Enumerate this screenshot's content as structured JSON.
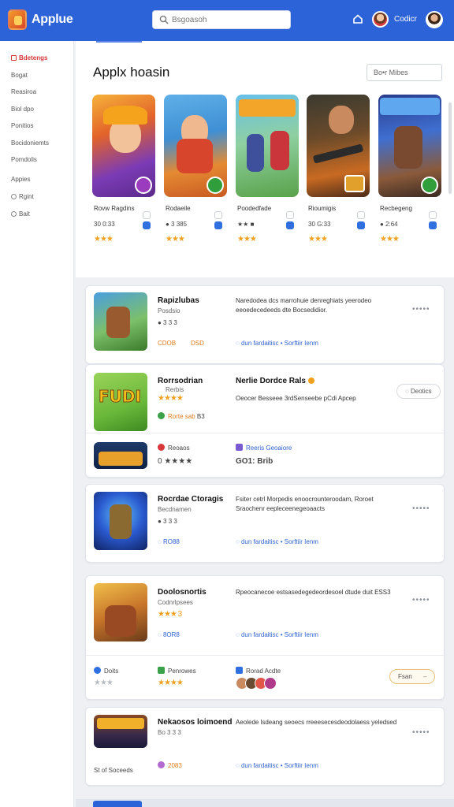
{
  "header": {
    "app_title": "Applue",
    "search_placeholder": "Bsgoasoh",
    "user_name": "Codicr"
  },
  "sidebar": {
    "items": [
      {
        "label": "Bdetengs",
        "icon": "grid-icon",
        "active": true
      },
      {
        "label": "Bogat"
      },
      {
        "label": "Reasiroa"
      },
      {
        "label": "Biol dpo"
      },
      {
        "label": "Ponitios"
      },
      {
        "label": "Bocidoniemts"
      },
      {
        "label": "Pomdolis"
      },
      {
        "label": "Appies"
      },
      {
        "label": "Rgint",
        "icon": "settings-icon"
      },
      {
        "label": "Bait",
        "icon": "gear-icon"
      }
    ]
  },
  "featured": {
    "title": "Applx hoasin",
    "more_label": "Bo•r Mibes",
    "games": [
      {
        "name": "Rovw Ragdins",
        "price": "30 0:33",
        "stars": "★★★",
        "badge_color": "#9b3bbd"
      },
      {
        "name": "Rodaeile",
        "price": "● 3 385",
        "stars": "★★★",
        "badge_color": "#2f9e3b"
      },
      {
        "name": "Poodedfade",
        "price": "★★ ■",
        "stars": "★★★",
        "badge_color": "#d84d2c"
      },
      {
        "name": "Rioumigis",
        "price": "30 G:33",
        "stars": "★★★",
        "badge_color": "#e0a02b"
      },
      {
        "name": "Recbegeng",
        "price": "● 2:64",
        "stars": "★★★",
        "badge_color": "#2f9e3b"
      }
    ]
  },
  "list": [
    {
      "title": "Rapizlubas",
      "sub": "Posdsio",
      "rating": "● 3 3 3",
      "tag": "CDOB",
      "tag2": "DSD",
      "desc": "Naredodea dcs marrohuie denreghiats yeerodeo eeoedecedeeds dte Bocsedidior.",
      "link": "◌ dun fardaitisc • Sorftiir Ienm",
      "dots": "•••••"
    },
    {
      "title": "Rorrsodrian",
      "sub": "Rerbis",
      "rating": "★★★★",
      "tag": "Rorte sab",
      "tag2": "B3",
      "badge_label": "FUDI",
      "desc_title": "Nerlie Dordce Rals",
      "desc": "Oeocer Besseee 3rdSenseebe pCdi Apcep",
      "follow": "◌ Deotics",
      "sub_items": [
        {
          "label": "Reoaos",
          "meta": "0 ★★★★"
        },
        {
          "label": "Reeris Geoaiore",
          "meta": "GO1: Brib"
        }
      ]
    },
    {
      "title": "Rocrdae Ctoragis",
      "sub": "Becdnamen",
      "rating": "● 3 3 3",
      "tag": "◌ RO88",
      "desc": "Fsiter cetrl Morpedis enoocrounteroodam, Roroet Sraochenr eepleceenegeoaacts",
      "link": "◌ dun fardaitisc • Sorftiir Ienm",
      "dots": "•••••"
    },
    {
      "title": "Doolosnortis",
      "sub": "Codnrlpsees",
      "rating": "★★★ 3",
      "tag": "◌ 8OR8",
      "desc": "Rpeocanecoe estsasedegedeordesoel dtude duit ESS3",
      "link": "◌ dun fardaitisc • Sorftiir Ienm",
      "dots": "•••••",
      "sub_items": [
        {
          "label": "Doits",
          "meta": "★★★"
        },
        {
          "label": "Penrowes",
          "meta": "★★★★"
        },
        {
          "label": "Rorad Acdte",
          "meta": ""
        }
      ],
      "pill": "Fsan"
    },
    {
      "title": "Nekaosos loimoend",
      "sub": "Bo 3 3 3",
      "rating": "",
      "tag": "2083",
      "desc": "Aeolede lsdeang seoecs rreeesecesdeodolaess yeledsed",
      "link": "◌ dun fardaitisc • Sorftiir Ienm",
      "dots": "•••••",
      "footer": "St of Soceeds"
    }
  ],
  "colors": {
    "header_blue": "#2d63d8",
    "accent_red": "#d6373b",
    "star_orange": "#f0a020",
    "link_blue": "#2f64d0"
  }
}
